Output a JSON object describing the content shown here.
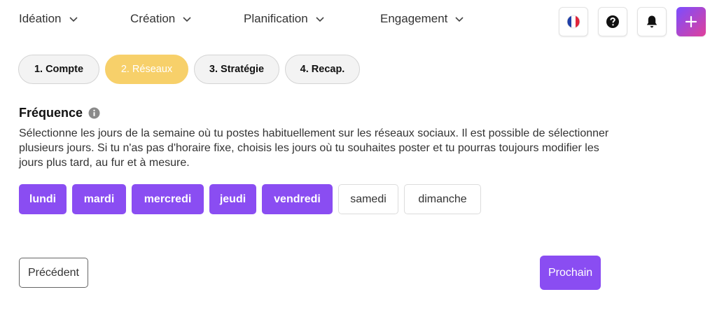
{
  "nav": {
    "items": [
      {
        "label": "Idéation"
      },
      {
        "label": "Création"
      },
      {
        "label": "Planification"
      },
      {
        "label": "Engagement"
      }
    ]
  },
  "steps": [
    {
      "label": "1. Compte",
      "active": false
    },
    {
      "label": "2. Réseaux",
      "active": true
    },
    {
      "label": "3. Stratégie",
      "active": false
    },
    {
      "label": "4. Recap.",
      "active": false
    }
  ],
  "section": {
    "title": "Fréquence",
    "description": "Sélectionne les jours de la semaine où tu postes habituellement sur les réseaux sociaux. Il est possible de sélectionner plusieurs jours. Si tu n'as pas d'horaire fixe, choisis les jours où tu souhaites poster et tu pourras toujours modifier les jours plus tard, au fur et à mesure."
  },
  "days": [
    {
      "label": "lundi",
      "selected": true
    },
    {
      "label": "mardi",
      "selected": true
    },
    {
      "label": "mercredi",
      "selected": true
    },
    {
      "label": "jeudi",
      "selected": true
    },
    {
      "label": "vendredi",
      "selected": true
    },
    {
      "label": "samedi",
      "selected": false
    },
    {
      "label": "dimanche",
      "selected": false
    }
  ],
  "buttons": {
    "previous": "Précédent",
    "next": "Prochain"
  },
  "colors": {
    "accent": "#8a4df2",
    "active_step": "#f7d06a"
  },
  "icons": [
    "chevron-down-icon",
    "french-flag-icon",
    "help-icon",
    "bell-icon",
    "plus-icon",
    "info-icon"
  ]
}
